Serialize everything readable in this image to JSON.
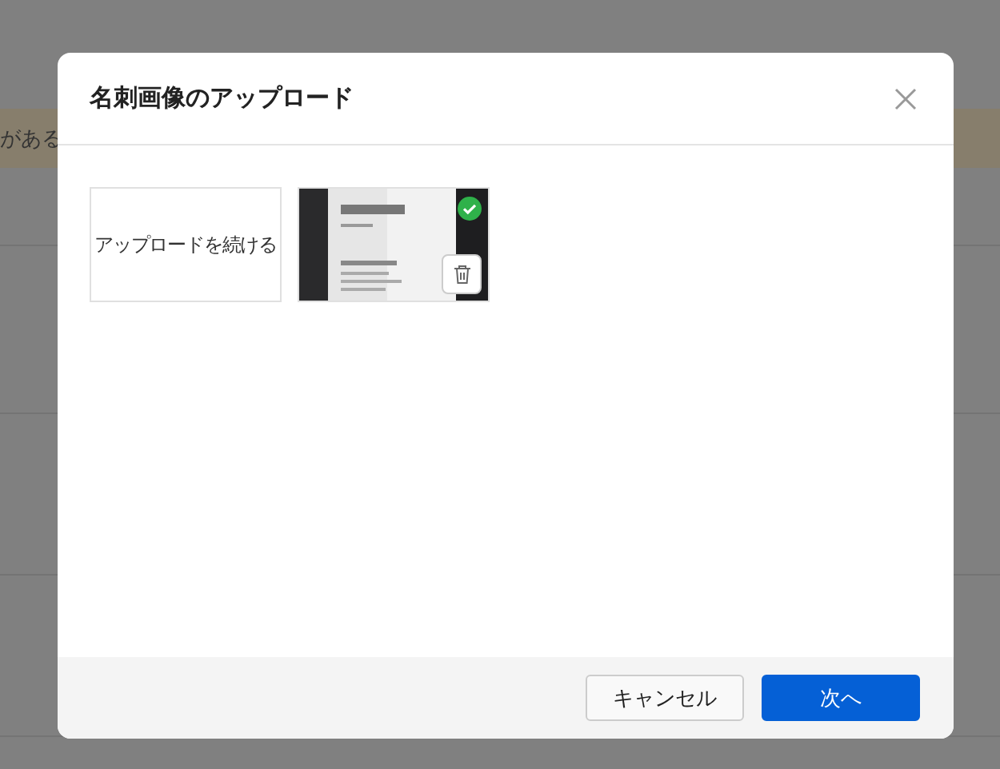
{
  "background": {
    "banner_text": "がある"
  },
  "dialog": {
    "title": "名刺画像のアップロード",
    "upload_tile": {
      "label": "アップロードを続ける"
    },
    "images": [
      {
        "kind": "picture",
        "uploaded": true
      }
    ],
    "buttons": [
      {
        "label": "キャンセル",
        "kind": "secondary"
      },
      {
        "label": "次へ",
        "kind": "primary"
      }
    ]
  }
}
